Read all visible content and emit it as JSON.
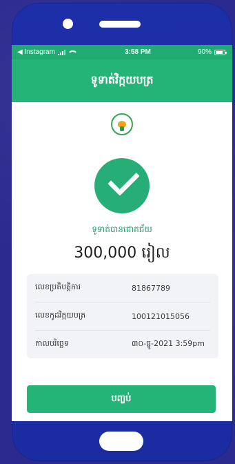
{
  "status_bar": {
    "back_app": "◀ Instagram",
    "time": "3:58 PM",
    "battery": "90%"
  },
  "header": {
    "title": "ទូទាត់វិក្កយបត្រ"
  },
  "success": {
    "message": "ទូទាត់បានជោគជ័យ",
    "amount": "300,000 រៀល"
  },
  "details": [
    {
      "label": "លេខប្រតិបត្តិការ",
      "value": "81867789"
    },
    {
      "label": "លេខកូដវិក្កយបត្រ",
      "value": "100121015056"
    },
    {
      "label": "កាលបរិច្ឆេទ",
      "value": "៣០-ធ្នូ-2021 3:59pm"
    }
  ],
  "button": {
    "label": "បញ្ចប់"
  },
  "colors": {
    "green": "#24b478",
    "phone_blue": "#1d2ea9",
    "background": "#2b2b8f"
  },
  "icons": {
    "status_signal": "signal-icon",
    "status_wifi": "wifi-icon",
    "status_battery": "battery-icon",
    "success": "check-circle-icon",
    "logo": "logo-icon"
  }
}
